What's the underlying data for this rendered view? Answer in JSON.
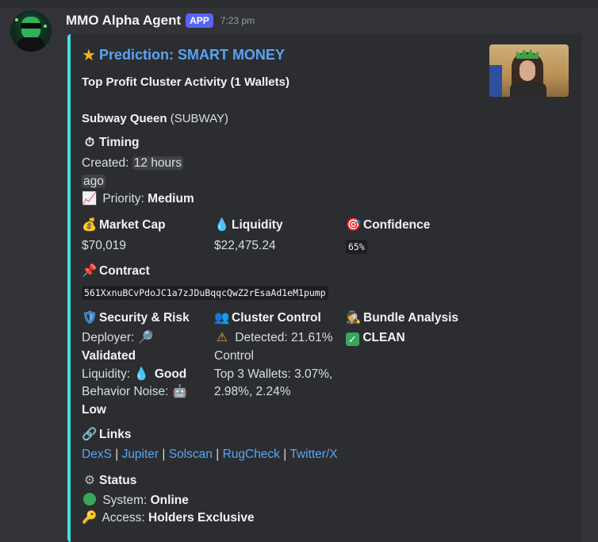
{
  "message": {
    "username": "MMO Alpha Agent",
    "badge": "APP",
    "timestamp": "7:23 pm"
  },
  "embed": {
    "accent_color": "#3fe0e0",
    "title": "Prediction: SMART MONEY",
    "description": "Top Profit Cluster Activity (1 Wallets)",
    "token_name": "Subway Queen",
    "token_symbol": "(SUBWAY)",
    "timing": {
      "label": "Timing",
      "created_label": "Created:",
      "created_value_1": "12 hours",
      "created_value_2": "ago",
      "priority_label": "Priority:",
      "priority_value": "Medium"
    },
    "market_cap": {
      "label": "Market Cap",
      "value": "$70,019"
    },
    "liquidity": {
      "label": "Liquidity",
      "value": "$22,475.24"
    },
    "confidence": {
      "label": "Confidence",
      "value": "65%"
    },
    "contract": {
      "label": "Contract",
      "value": "561XxnuBCvPdoJC1a7zJDuBqqcQwZ2rEsaAd1eM1pump"
    },
    "security": {
      "label": "Security & Risk",
      "deployer_label": "Deployer:",
      "deployer_value": "Validated",
      "liquidity_label": "Liquidity:",
      "liquidity_value": "Good",
      "noise_label": "Behavior Noise:",
      "noise_value": "Low"
    },
    "cluster": {
      "label": "Cluster Control",
      "detected": "Detected: 21.61%",
      "detected_2": "Control",
      "top3_1": "Top 3 Wallets: 3.07%,",
      "top3_2": "2.98%, 2.24%"
    },
    "bundle": {
      "label": "Bundle Analysis",
      "value": "CLEAN"
    },
    "links": {
      "label": "Links",
      "items": [
        "DexS",
        "Jupiter",
        "Solscan",
        "RugCheck",
        "Twitter/X"
      ],
      "separator": "|"
    },
    "status": {
      "label": "Status",
      "system_label": "System:",
      "system_value": "Online",
      "access_label": "Access:",
      "access_value": "Holders Exclusive"
    }
  }
}
